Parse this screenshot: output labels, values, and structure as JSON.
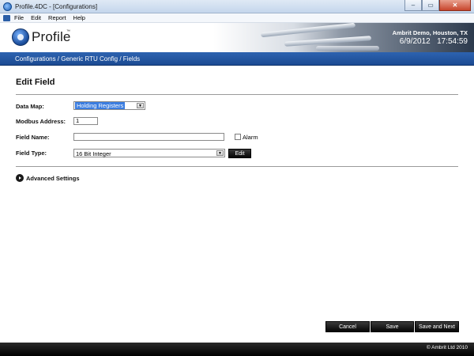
{
  "window": {
    "title": "Profile.4DC - [Configurations]",
    "minimize_glyph": "–",
    "restore_glyph": "▭",
    "close_glyph": "✕"
  },
  "menu": {
    "items": [
      "File",
      "Edit",
      "Report",
      "Help"
    ]
  },
  "header": {
    "logo_text": "Profile",
    "logo_tm": "™",
    "organization": "Ambrit Demo, Houston, TX",
    "date": "6/9/2012",
    "time": "17:54:59"
  },
  "breadcrumb": {
    "text": "Configurations / Generic RTU Config / Fields"
  },
  "form": {
    "title": "Edit Field",
    "data_map": {
      "label": "Data Map:",
      "value": "Holding Registers"
    },
    "modbus_address": {
      "label": "Modbus Address:",
      "value": "1"
    },
    "field_name": {
      "label": "Field Name:",
      "value": ""
    },
    "alarm": {
      "label": "Alarm",
      "checked": false
    },
    "field_type": {
      "label": "Field Type:",
      "value": "16 Bit Integer",
      "edit_label": "Edit"
    },
    "advanced": {
      "label": "Advanced Settings"
    }
  },
  "actions": {
    "cancel": "Cancel",
    "save": "Save",
    "save_next": "Save and Next"
  },
  "footer": {
    "copyright": "© Ambrit Ltd 2010"
  },
  "colors": {
    "breadcrumb_bg": "#1f539d",
    "selection": "#3b7de0",
    "button_bg": "#111111"
  },
  "icons": {
    "app": "profile-app-icon",
    "logo": "profile-logo-icon",
    "advanced": "expand-arrow-icon",
    "dropdown": "chevron-down-icon"
  }
}
